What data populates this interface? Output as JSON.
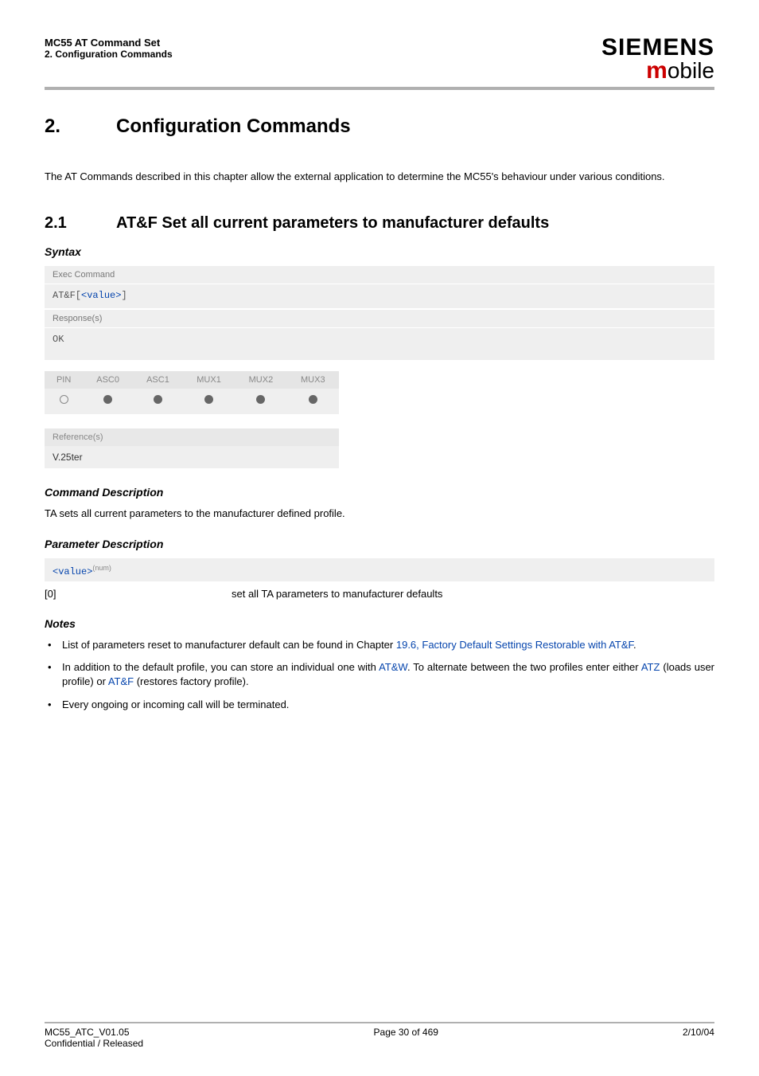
{
  "header": {
    "title": "MC55 AT Command Set",
    "subtitle": "2. Configuration Commands",
    "brand_main": "SIEMENS",
    "brand_sub_m": "m",
    "brand_sub_rest": "obile"
  },
  "chapter": {
    "num": "2.",
    "title": "Configuration Commands"
  },
  "intro": "The AT Commands described in this chapter allow the external application to determine the MC55's behaviour under various conditions.",
  "section": {
    "num": "2.1",
    "title": "AT&F   Set all current parameters to manufacturer defaults"
  },
  "syntax": {
    "heading": "Syntax",
    "exec_label": "Exec Command",
    "exec_code_prefix": "AT&F[",
    "exec_code_link": "<value>",
    "exec_code_suffix": "]",
    "resp_label": "Response(s)",
    "resp_code": "OK"
  },
  "pin_table": {
    "headers": [
      "PIN",
      "ASC0",
      "ASC1",
      "MUX1",
      "MUX2",
      "MUX3"
    ],
    "row_types": [
      "empty",
      "full",
      "full",
      "full",
      "full",
      "full"
    ]
  },
  "reference": {
    "label": "Reference(s)",
    "value": "V.25ter"
  },
  "cmd_desc": {
    "heading": "Command Description",
    "text": "TA sets all current parameters to the manufacturer defined profile."
  },
  "param_desc": {
    "heading": "Parameter Description",
    "param_name": "<value>",
    "param_sup": "(num)",
    "rows": [
      {
        "k": "[0]",
        "v": "set all TA parameters to manufacturer defaults"
      }
    ]
  },
  "notes": {
    "heading": "Notes",
    "items": [
      {
        "parts": [
          {
            "t": "List of parameters reset to manufacturer default can be found in Chapter "
          },
          {
            "link": "19.6, Factory Default Settings Restorable with AT&F"
          },
          {
            "t": "."
          }
        ]
      },
      {
        "parts": [
          {
            "t": "In addition to the default profile, you can store an individual one with "
          },
          {
            "link": "AT&W"
          },
          {
            "t": ". To alternate between the two profiles enter either "
          },
          {
            "link": "ATZ"
          },
          {
            "t": " (loads user profile) or "
          },
          {
            "link": "AT&F"
          },
          {
            "t": " (restores factory profile)."
          }
        ]
      },
      {
        "parts": [
          {
            "t": "Every ongoing or incoming call will be terminated."
          }
        ]
      }
    ]
  },
  "footer": {
    "left1": "MC55_ATC_V01.05",
    "left2": "Confidential / Released",
    "center": "Page 30 of 469",
    "right": "2/10/04"
  }
}
